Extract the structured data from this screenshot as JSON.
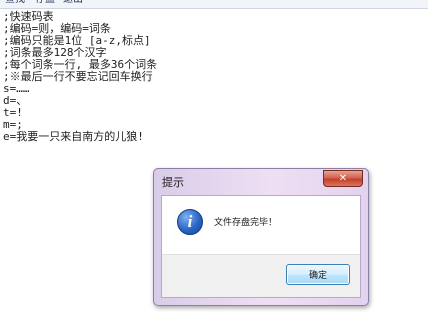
{
  "menubar": {
    "items": [
      {
        "label": "查找"
      },
      {
        "label": "存盘"
      },
      {
        "label": "退出"
      }
    ]
  },
  "editor": {
    "lines": [
      ";快速码表",
      ";编码=则，编码=词条",
      ";编码只能是1位 [a-z,标点]",
      ";词条最多128个汉字",
      ";每个词条一行, 最多36个词条",
      ";※最后一行不要忘记回车换行",
      "s=……",
      "d=、",
      "t=!",
      "m=;",
      "e=我要一只来自南方的儿狼!"
    ]
  },
  "dialog": {
    "title": "提示",
    "close_glyph": "✕",
    "icon": "info-icon",
    "icon_glyph": "i",
    "message": "文件存盘完毕！",
    "ok_label": "确定"
  },
  "colors": {
    "dialog_frame": "#e3d2ee",
    "close_button": "#c2412c",
    "info_icon": "#2a66c4",
    "ok_button": "#bee6fd"
  }
}
